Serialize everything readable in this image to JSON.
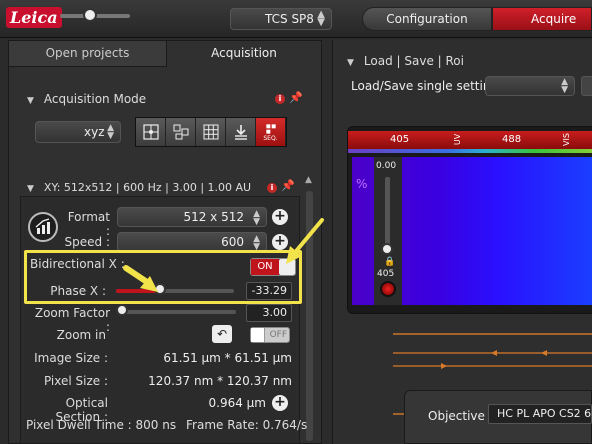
{
  "topbar": {
    "logo": "Leica",
    "scanner": "TCS SP8",
    "nav": {
      "configuration": "Configuration",
      "acquire": "Acquire"
    }
  },
  "tabs": {
    "open_projects": "Open projects",
    "acquisition": "Acquisition"
  },
  "acquisition_mode": {
    "header": "Acquisition Mode",
    "mode": "xyz",
    "seq_label": "SEQ."
  },
  "xy_section": {
    "header": "XY: 512x512 | 600 Hz | 3.00 | 1.00 AU",
    "format": {
      "label": "Format :",
      "value": "512 x 512"
    },
    "speed": {
      "label": "Speed :",
      "value": "600"
    },
    "bidirectional": {
      "label": "Bidirectional X :",
      "state": "ON"
    },
    "phase": {
      "label": "Phase X :",
      "value": "-33.29",
      "fraction": 0.38
    },
    "zoom_factor": {
      "label": "Zoom Factor :",
      "value": "3.00",
      "fraction": 0.0
    },
    "zoom_in": {
      "label": "Zoom in",
      "state": "OFF"
    },
    "image_size": {
      "label": "Image Size :",
      "value": "61.51 µm * 61.51 µm"
    },
    "pixel_size": {
      "label": "Pixel Size :",
      "value": "120.37 nm * 120.37 nm"
    },
    "optical_section": {
      "label": "Optical Section :",
      "value": "0.964 µm"
    },
    "pixel_dwell": {
      "label": "Pixel Dwell Time : 800 ns"
    },
    "frame_rate": {
      "label": "Frame Rate: 0.764/s"
    }
  },
  "right_panel": {
    "header": "Load | Save | Roi",
    "load_label": "Load/Save single setting :",
    "spectrum": {
      "ticks": [
        "405",
        "UV",
        "488",
        "VIS"
      ],
      "percent_symbol": "%",
      "laser_value": "0.00",
      "laser_line": "405"
    },
    "objective": {
      "label": "Objective :",
      "value": "HC PL APO CS2  6"
    }
  },
  "colors": {
    "accent_red": "#c0141d",
    "highlight_yellow": "#f2e34a"
  }
}
